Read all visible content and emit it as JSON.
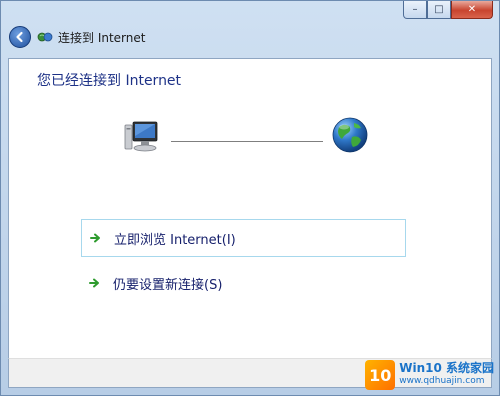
{
  "window": {
    "title": "连接到 Internet",
    "caption_min": "–",
    "caption_max": "□",
    "caption_close": "✕"
  },
  "heading": "您已经连接到 Internet",
  "options": [
    {
      "label": "立即浏览 Internet(I)",
      "icon": "green-arrow-icon",
      "hovered": true
    },
    {
      "label": "仍要设置新连接(S)",
      "icon": "green-arrow-icon",
      "hovered": false
    }
  ],
  "watermark": {
    "badge": "10",
    "brand": "Win10 系统家园",
    "url": "www.qdhuajin.com"
  },
  "colors": {
    "heading": "#1e3287",
    "option_text": "#151f6b",
    "arrow": "#2e9b2e",
    "hover_border": "#a7d8ed"
  }
}
